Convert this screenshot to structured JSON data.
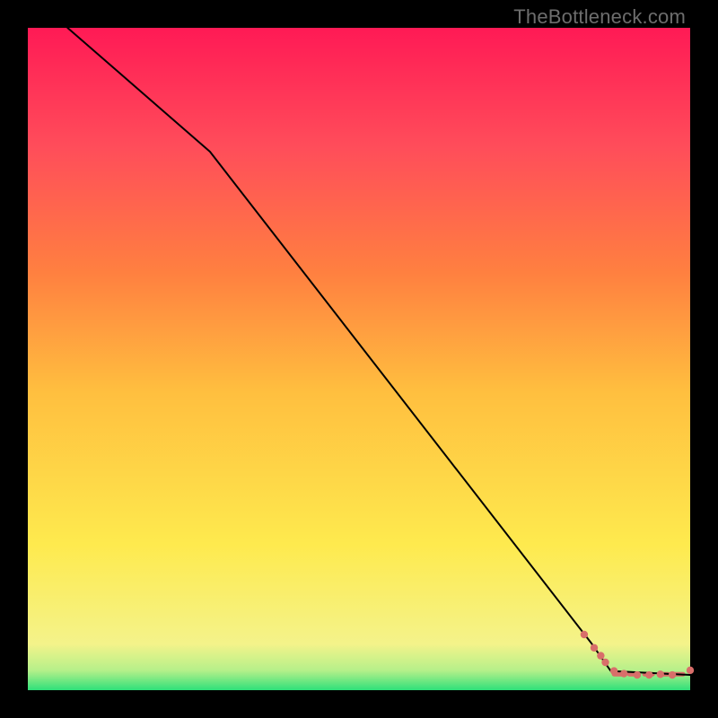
{
  "watermark": "TheBottleneck.com",
  "colors": {
    "curve": "#000000",
    "marker_fill": "#d86e6a",
    "marker_stroke": "#d86e6a",
    "dash": "#d86e6a"
  },
  "chart_data": {
    "type": "line",
    "title": "",
    "xlabel": "",
    "ylabel": "",
    "xlim": [
      0,
      100
    ],
    "ylim": [
      0,
      100
    ],
    "grid": false,
    "series": [
      {
        "name": "bottleneck-curve",
        "x": [
          6,
          27.5,
          85,
          88,
          100
        ],
        "y": [
          100,
          81.3,
          7.2,
          2.9,
          2.3
        ]
      }
    ],
    "points": {
      "name": "data-markers",
      "x": [
        84.0,
        85.5,
        86.5,
        87.2,
        88.5,
        90.0,
        92.0,
        93.8,
        95.5,
        97.3,
        100.0
      ],
      "y": [
        8.4,
        6.4,
        5.2,
        4.2,
        2.9,
        2.5,
        2.3,
        2.3,
        2.4,
        2.3,
        3.0
      ]
    },
    "dash_segment": {
      "x_start": 88.5,
      "x_end": 100,
      "y": 2.4
    }
  }
}
